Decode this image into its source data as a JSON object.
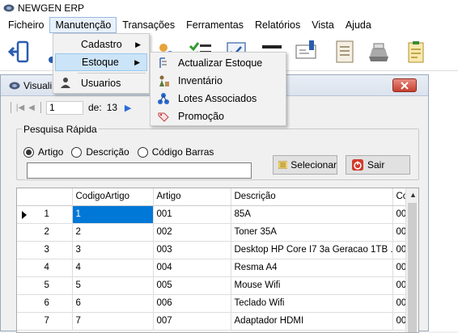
{
  "app": {
    "title": "NEWGEN ERP"
  },
  "menubar": {
    "items": [
      "Ficheiro",
      "Manutenção",
      "Transações",
      "Ferramentas",
      "Relatórios",
      "Vista",
      "Ajuda"
    ]
  },
  "menu_manutencao": {
    "items": [
      "Cadastro",
      "Estoque",
      "Usuarios"
    ]
  },
  "menu_estoque": {
    "items": [
      "Actualizar Estoque",
      "Inventário",
      "Lotes Associados",
      "Promoção"
    ]
  },
  "child_window": {
    "title": "Visuali"
  },
  "navigator": {
    "position": "1",
    "of_label": "de:",
    "count": "13"
  },
  "search": {
    "legend": "Pesquisa Rápida",
    "options": [
      "Artigo",
      "Descrição",
      "Código Barras"
    ],
    "selected": "Artigo",
    "value": ""
  },
  "buttons": {
    "select": "Selecionar",
    "exit": "Sair"
  },
  "grid": {
    "columns": [
      "CodigoArtigo",
      "Artigo",
      "Descrição",
      "Co"
    ],
    "rows": [
      {
        "num": "1",
        "codigo": "1",
        "artigo": "001",
        "descricao": "85A",
        "co": "00"
      },
      {
        "num": "2",
        "codigo": "2",
        "artigo": "002",
        "descricao": "Toner 35A",
        "co": "00"
      },
      {
        "num": "3",
        "codigo": "3",
        "artigo": "003",
        "descricao": "Desktop HP Core I7 3a Geracao 1TB ...",
        "co": "00"
      },
      {
        "num": "4",
        "codigo": "4",
        "artigo": "004",
        "descricao": "Resma A4",
        "co": "00"
      },
      {
        "num": "5",
        "codigo": "5",
        "artigo": "005",
        "descricao": "Mouse Wifi",
        "co": "00"
      },
      {
        "num": "6",
        "codigo": "6",
        "artigo": "006",
        "descricao": "Teclado Wifi",
        "co": "00"
      },
      {
        "num": "7",
        "codigo": "7",
        "artigo": "007",
        "descricao": "Adaptador HDMI",
        "co": "00"
      }
    ]
  },
  "colors": {
    "selection": "#0078d7",
    "menu_highlight": "#cce4f7",
    "close_button": "#c6402f"
  }
}
